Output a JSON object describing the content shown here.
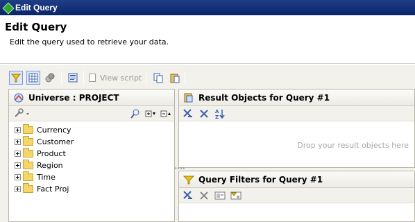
{
  "window": {
    "title": "Edit Query"
  },
  "header": {
    "title": "Edit Query",
    "description": "Edit the query used to retrieve your data."
  },
  "toolbar": {
    "view_script_label": "View script",
    "buttons": [
      "filter-pane-icon",
      "data-preview-icon",
      "combined-query-icon",
      "properties-icon",
      "view-script-icon",
      "copy-icon",
      "paste-icon"
    ]
  },
  "universe_panel": {
    "title": "Universe : PROJECT",
    "items": [
      {
        "label": "Currency"
      },
      {
        "label": "Customer"
      },
      {
        "label": "Product"
      },
      {
        "label": "Region"
      },
      {
        "label": "Time"
      },
      {
        "label": "Fact Proj"
      }
    ]
  },
  "result_panel": {
    "title": "Result Objects for Query #1",
    "drop_hint": "Drop your result objects here"
  },
  "filters_panel": {
    "title": "Query Filters for Query #1"
  },
  "colors": {
    "title_bar": "#0a246a",
    "panel_bg": "#f2f1ec",
    "folder": "#f5d66b",
    "filter_yellow": "#f0c419"
  }
}
